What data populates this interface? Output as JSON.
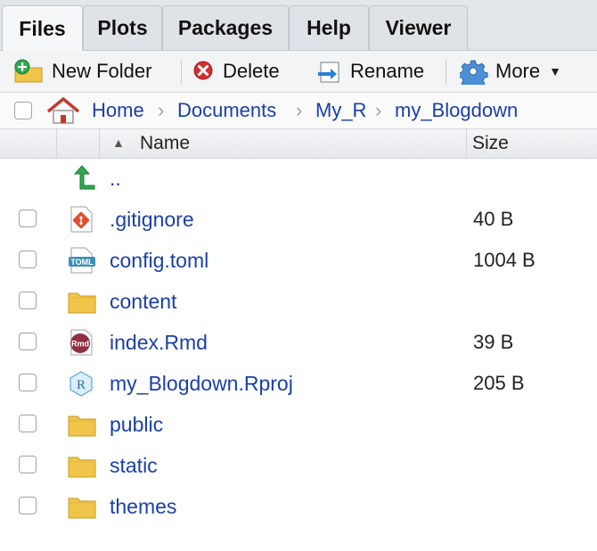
{
  "tabs": [
    {
      "label": "Files",
      "active": true
    },
    {
      "label": "Plots"
    },
    {
      "label": "Packages"
    },
    {
      "label": "Help"
    },
    {
      "label": "Viewer"
    }
  ],
  "toolbar": {
    "new_folder": "New Folder",
    "delete": "Delete",
    "rename": "Rename",
    "more": "More"
  },
  "breadcrumb": [
    "Home",
    "Documents",
    "My_R",
    "my_Blogdown"
  ],
  "columns": {
    "name": "Name",
    "size": "Size"
  },
  "files": [
    {
      "name": "..",
      "size": "",
      "icon": "parent-folder-icon"
    },
    {
      "name": ".gitignore",
      "size": "40 B",
      "icon": "git-file-icon"
    },
    {
      "name": "config.toml",
      "size": "1004 B",
      "icon": "toml-file-icon"
    },
    {
      "name": "content",
      "size": "",
      "icon": "folder-icon"
    },
    {
      "name": "index.Rmd",
      "size": "39 B",
      "icon": "rmd-file-icon"
    },
    {
      "name": "my_Blogdown.Rproj",
      "size": "205 B",
      "icon": "rproj-file-icon"
    },
    {
      "name": "public",
      "size": "",
      "icon": "folder-icon"
    },
    {
      "name": "static",
      "size": "",
      "icon": "folder-icon"
    },
    {
      "name": "themes",
      "size": "",
      "icon": "folder-icon"
    }
  ],
  "icon_labels": {
    "toml": "TOML",
    "rmd": "Rmd",
    "rproj": "R"
  },
  "colors": {
    "link": "#1a3fa8",
    "folder": "#f0c64a",
    "up_arrow": "#2fa84f",
    "delete": "#d22f2f"
  }
}
